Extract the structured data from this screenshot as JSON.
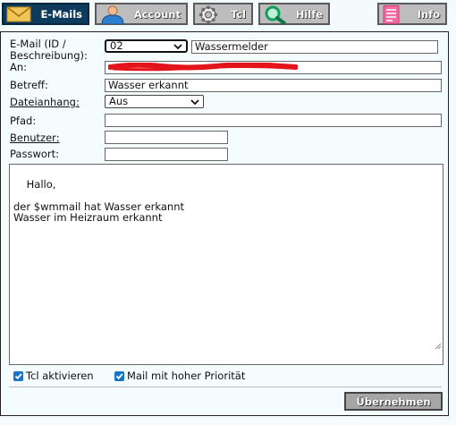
{
  "tabs": {
    "emails": "E-Mails",
    "account": "Account",
    "tcl": "Tcl",
    "hilfe": "Hilfe",
    "info": "Info"
  },
  "form": {
    "email_id_label": "E-Mail (ID /\nBeschreibung):",
    "email_id_value": "02",
    "description_value": "Wassermelder",
    "to_label": "An:",
    "to_value": "",
    "subject_label": "Betreff:",
    "subject_value": "Wasser erkannt",
    "attachment_label": "Dateianhang:",
    "attachment_value": "Aus",
    "path_label": "Pfad:",
    "path_value": "",
    "user_label": "Benutzer:",
    "user_value": "",
    "password_label": "Passwort:",
    "password_value": "",
    "body_text": "Hallo,\n\nder $wmmail hat Wasser erkannt\nWasser im Heizraum erkannt",
    "tcl_checkbox_label": "Tcl aktivieren",
    "priority_checkbox_label": "Mail mit hoher Priorität",
    "submit_label": "Übernehmen"
  },
  "icons": {
    "emails": "envelope-icon",
    "account": "user-icon",
    "tcl": "gear-icon",
    "hilfe": "magnifier-icon",
    "info": "document-icon"
  },
  "colors": {
    "active_tab": "#0d3b5e",
    "inactive_tab": "#bdbdbd",
    "checkbox": "#1a73c9",
    "redaction": "#e3141a"
  }
}
